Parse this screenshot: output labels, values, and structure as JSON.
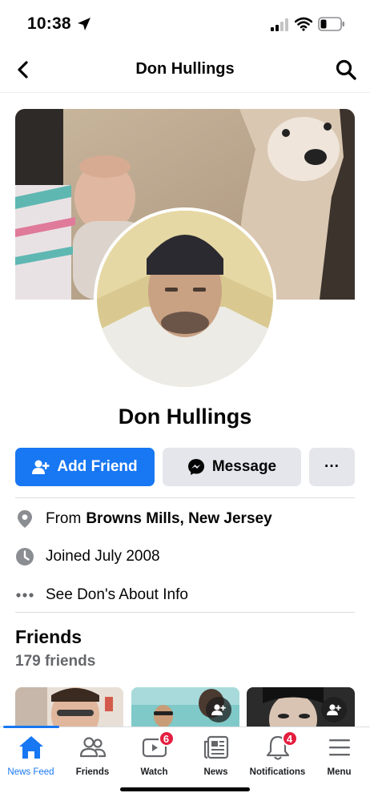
{
  "status_bar": {
    "time": "10:38",
    "location_icon": "location-arrow-icon",
    "signal_icon": "cellular-signal-icon",
    "wifi_icon": "wifi-icon",
    "battery_icon": "battery-low-icon"
  },
  "header": {
    "title": "Don Hullings",
    "back_icon": "chevron-left-icon",
    "search_icon": "search-icon"
  },
  "profile": {
    "name": "Don Hullings"
  },
  "actions": {
    "add_friend_label": "Add Friend",
    "message_label": "Message",
    "more_label": "···"
  },
  "info": {
    "from_prefix": "From",
    "from_place": "Browns Mills, New Jersey",
    "joined": "Joined July 2008",
    "about_link": "See Don's About Info"
  },
  "friends": {
    "title": "Friends",
    "count": "179 friends"
  },
  "tabbar": {
    "tabs": [
      {
        "label": "News Feed",
        "icon": "home-icon",
        "active": true
      },
      {
        "label": "Friends",
        "icon": "friends-icon"
      },
      {
        "label": "Watch",
        "icon": "watch-icon",
        "badge": "6"
      },
      {
        "label": "News",
        "icon": "news-icon"
      },
      {
        "label": "Notifications",
        "icon": "bell-icon",
        "badge": "4"
      },
      {
        "label": "Menu",
        "icon": "menu-icon"
      }
    ]
  },
  "colors": {
    "accent": "#1877f2",
    "button_gray": "#e4e6eb",
    "badge_red": "#e41e3f",
    "secondary_text": "#65676b"
  }
}
